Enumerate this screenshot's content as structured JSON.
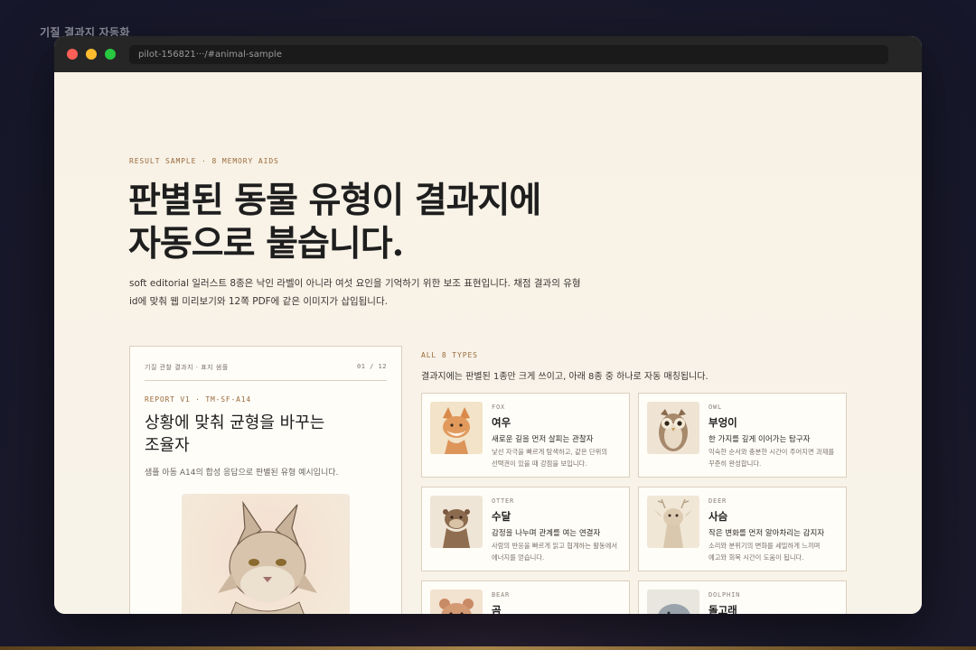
{
  "outer_title": "기질 결과지 자동화",
  "browser": {
    "url": "pilot-156821···/#animal-sample"
  },
  "hero": {
    "eyebrow": "RESULT SAMPLE · 8 MEMORY AIDS",
    "headline_line1": "판별된 동물 유형이 결과지에",
    "headline_line2": "자동으로 붙습니다.",
    "intro_line1": "soft editorial 일러스트 8종은 낙인 라벨이 아니라 여섯 요인을 기억하기 위한 보조 표현입니다. 채점 결과의 유형",
    "intro_line2": "id에 맞춰 웹 미리보기와 12쪽 PDF에 같은 이미지가 삽입됩니다."
  },
  "sheet": {
    "header_left": "기질 관찰 결과지 · 표지 샘플",
    "header_right": "01 / 12",
    "code": "REPORT V1 · TM-SF-A14",
    "title_line1": "상황에 맞춰 균형을 바꾸는",
    "title_line2": "조율자",
    "desc": "샘플 아동 A14의 합성 응답으로 판별된 유형 예시입니다."
  },
  "types": {
    "eyebrow": "ALL 8 TYPES",
    "desc": "결과지에는 판별된 1종만 크게 쓰이고, 아래 8종 중 하나로 자동 매칭됩니다.",
    "cards": [
      {
        "code": "FOX",
        "name": "여우",
        "role": "새로운 길을 먼저 살피는 관찰자",
        "desc1": "낯선 자극을 빠르게 탐색하고, 같은 단위의",
        "desc2": "선택권이 있을 때 강점을 보입니다.",
        "icon": "fox-icon"
      },
      {
        "code": "OWL",
        "name": "부엉이",
        "role": "한 가지를 깊게 이어가는 탐구자",
        "desc1": "익숙한 순서와 충분한 시간이 주어지면 과제를",
        "desc2": "꾸준히 완성합니다.",
        "icon": "owl-icon"
      },
      {
        "code": "OTTER",
        "name": "수달",
        "role": "감정을 나누며 관계를 여는 연결자",
        "desc1": "사람의 반응을 빠르게 읽고 협계하는 활동에서",
        "desc2": "에너지를 얻습니다.",
        "icon": "otter-icon"
      },
      {
        "code": "DEER",
        "name": "사슴",
        "role": "작은 변화를 먼저 알아차리는 감지자",
        "desc1": "소리와 분위기의 변화를 세밀하게 느끼며",
        "desc2": "예고와 회복 시간이 도움이 됩니다.",
        "icon": "deer-icon"
      },
      {
        "code": "BEAR",
        "name": "곰",
        "role": "",
        "desc1": "",
        "desc2": "",
        "icon": "bear-icon"
      },
      {
        "code": "DOLPHIN",
        "name": "돌고래",
        "role": "",
        "desc1": "",
        "desc2": "",
        "icon": "dolphin-icon"
      }
    ]
  },
  "colors": {
    "accent": "#9a6b3c",
    "paper": "#f8f2e7",
    "card": "#fffdf8",
    "border": "#dccfbd"
  }
}
